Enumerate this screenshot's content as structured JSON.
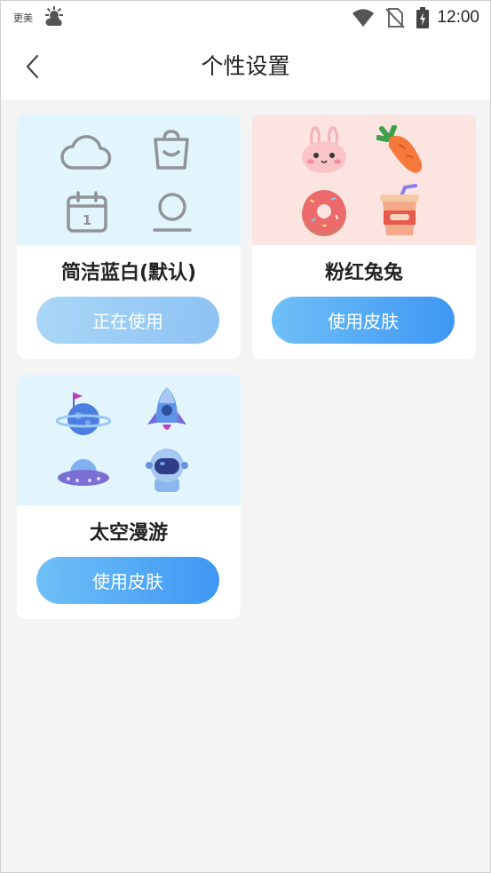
{
  "status_bar": {
    "app_name": "更美",
    "time": "12:00"
  },
  "header": {
    "title": "个性设置",
    "back_icon": "chevron-left-icon"
  },
  "skins": [
    {
      "name": "简洁蓝白(默认)",
      "button_label": "正在使用",
      "in_use": true,
      "preview_bg": "#e3f5fc",
      "icons": [
        "cloud-icon",
        "shopping-bag-icon",
        "calendar-icon",
        "user-icon"
      ]
    },
    {
      "name": "粉红兔兔",
      "button_label": "使用皮肤",
      "in_use": false,
      "preview_bg": "#fce4e1",
      "icons": [
        "bunny-icon",
        "carrot-icon",
        "donut-icon",
        "drink-cup-icon"
      ]
    },
    {
      "name": "太空漫游",
      "button_label": "使用皮肤",
      "in_use": false,
      "preview_bg": "#e3f5fc",
      "icons": [
        "planet-flag-icon",
        "rocket-icon",
        "ufo-icon",
        "astronaut-icon"
      ]
    }
  ],
  "calendar_day": "1",
  "colors": {
    "accent_start": "#6fc0f7",
    "accent_end": "#3e97f3",
    "in_use_start": "#a9d7f7",
    "in_use_end": "#8dc2f3",
    "page_bg": "#f4f4f4"
  }
}
